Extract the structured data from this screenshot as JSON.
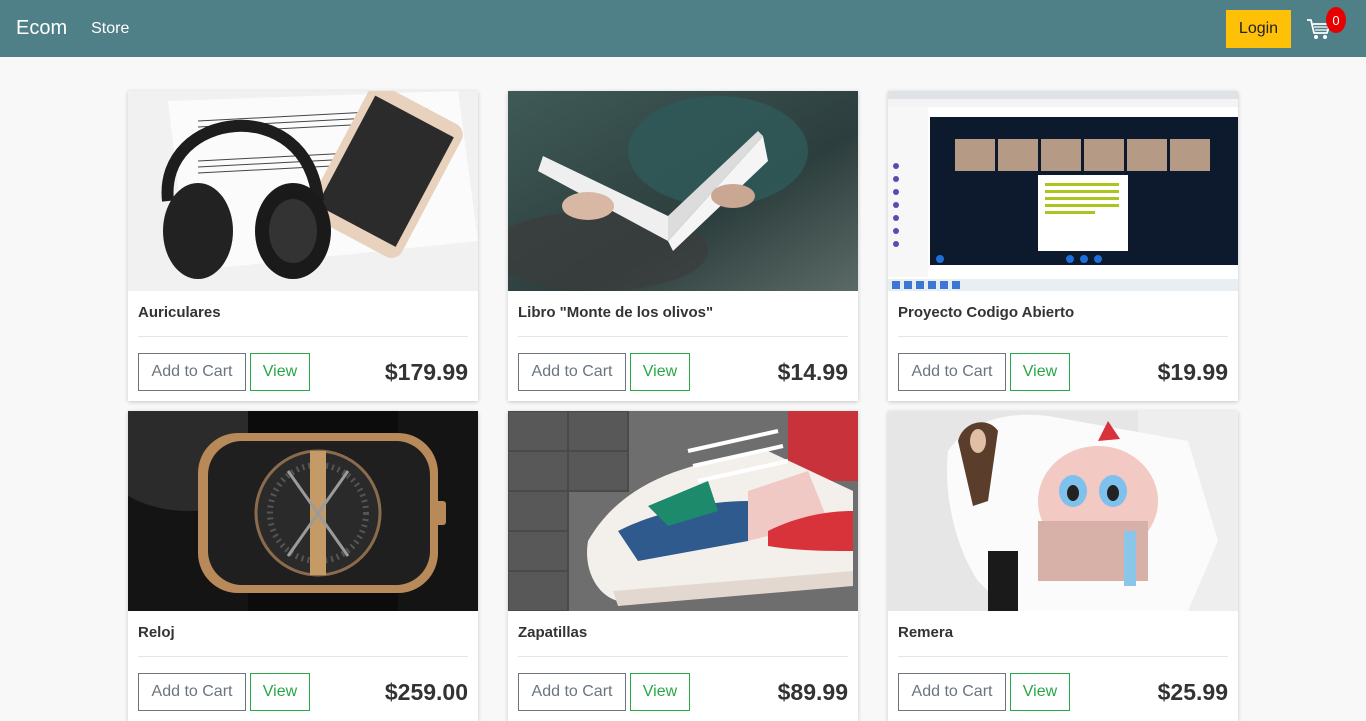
{
  "nav": {
    "brand": "Ecom",
    "store_link": "Store",
    "login_label": "Login",
    "cart_count": "0"
  },
  "buttons": {
    "add_to_cart": "Add to Cart",
    "view": "View"
  },
  "products": [
    {
      "name": "Auriculares",
      "price": "$179.99",
      "image": "headphones-photo"
    },
    {
      "name": "Libro \"Monte de los olivos\"",
      "price": "$14.99",
      "image": "book-photo"
    },
    {
      "name": "Proyecto Codigo Abierto",
      "price": "$19.99",
      "image": "video-call-screenshot"
    },
    {
      "name": "Reloj",
      "price": "$259.00",
      "image": "watch-photo"
    },
    {
      "name": "Zapatillas",
      "price": "$89.99",
      "image": "sneakers-photo"
    },
    {
      "name": "Remera",
      "price": "$25.99",
      "image": "tshirt-photo"
    }
  ],
  "colors": {
    "navbar": "#4f7f87",
    "login_button": "#ffc107",
    "badge": "#e60000",
    "view_button": "#28a745",
    "cart_button": "#6c757d"
  }
}
